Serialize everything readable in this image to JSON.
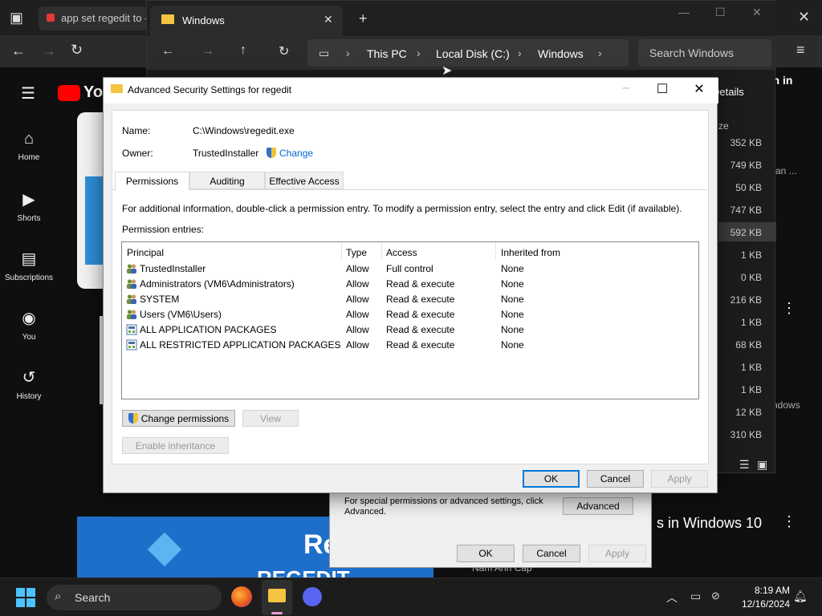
{
  "browser": {
    "tab_title": "app set regedit to - ",
    "toolbar_icons": [
      "back-icon",
      "forward-icon",
      "refresh-icon",
      "menu-icon"
    ]
  },
  "youtube": {
    "logo": "You",
    "sign_in": "gn in",
    "nav": [
      {
        "label": "Home",
        "icon": "home-icon"
      },
      {
        "label": "Shorts",
        "icon": "shorts-icon"
      },
      {
        "label": "Subscriptions",
        "icon": "subscriptions-icon"
      },
      {
        "label": "You",
        "icon": "you-icon"
      },
      {
        "label": "History",
        "icon": "history-icon"
      }
    ],
    "side_text_1": "can ...",
    "side_text_2": "ndows",
    "video_title_fragment": "s in Windows 10",
    "thumbnail_text_1": "Res",
    "thumbnail_text_2": "REGEDIT",
    "channel_name": "Nam Anh Cap"
  },
  "explorer": {
    "tab_title": "Windows",
    "breadcrumb": [
      "This PC",
      "Local Disk (C:)",
      "Windows"
    ],
    "search_placeholder": "Search Windows",
    "details_label": "Details",
    "size_header": "ze",
    "sizes": [
      "352 KB",
      "749 KB",
      "50 KB",
      "747 KB",
      "592 KB",
      "1 KB",
      "0 KB",
      "216 KB",
      "1 KB",
      "68 KB",
      "1 KB",
      "1 KB",
      "12 KB",
      "310 KB"
    ]
  },
  "dialog": {
    "title": "Advanced Security Settings for regedit",
    "name_label": "Name:",
    "name_value": "C:\\Windows\\regedit.exe",
    "owner_label": "Owner:",
    "owner_value": "TrustedInstaller",
    "change_link": "Change",
    "tabs": [
      "Permissions",
      "Auditing",
      "Effective Access"
    ],
    "info_text": "For additional information, double-click a permission entry. To modify a permission entry, select the entry and click Edit (if available).",
    "entries_label": "Permission entries:",
    "columns": [
      "Principal",
      "Type",
      "Access",
      "Inherited from"
    ],
    "entries": [
      {
        "principal": "TrustedInstaller",
        "type": "Allow",
        "access": "Full control",
        "inherited": "None",
        "icon": "user-group-icon"
      },
      {
        "principal": "Administrators (VM6\\Administrators)",
        "type": "Allow",
        "access": "Read & execute",
        "inherited": "None",
        "icon": "user-group-icon"
      },
      {
        "principal": "SYSTEM",
        "type": "Allow",
        "access": "Read & execute",
        "inherited": "None",
        "icon": "user-group-icon"
      },
      {
        "principal": "Users (VM6\\Users)",
        "type": "Allow",
        "access": "Read & execute",
        "inherited": "None",
        "icon": "user-group-icon"
      },
      {
        "principal": "ALL APPLICATION PACKAGES",
        "type": "Allow",
        "access": "Read & execute",
        "inherited": "None",
        "icon": "package-icon"
      },
      {
        "principal": "ALL RESTRICTED APPLICATION PACKAGES",
        "type": "Allow",
        "access": "Read & execute",
        "inherited": "None",
        "icon": "package-icon"
      }
    ],
    "change_permissions_button": "Change permissions",
    "view_button": "View",
    "enable_inheritance_button": "Enable inheritance",
    "ok_button": "OK",
    "cancel_button": "Cancel",
    "apply_button": "Apply"
  },
  "properties_dialog": {
    "text": "For special permissions or advanced settings, click Advanced.",
    "advanced_button": "Advanced",
    "ok_button": "OK",
    "cancel_button": "Cancel",
    "apply_button": "Apply"
  },
  "taskbar": {
    "search_label": "Search",
    "time": "8:19 AM",
    "date": "12/16/2024"
  },
  "colors": {
    "accent": "#0078d7",
    "youtube_red": "#ff0000",
    "folder_yellow": "#f4c542"
  }
}
